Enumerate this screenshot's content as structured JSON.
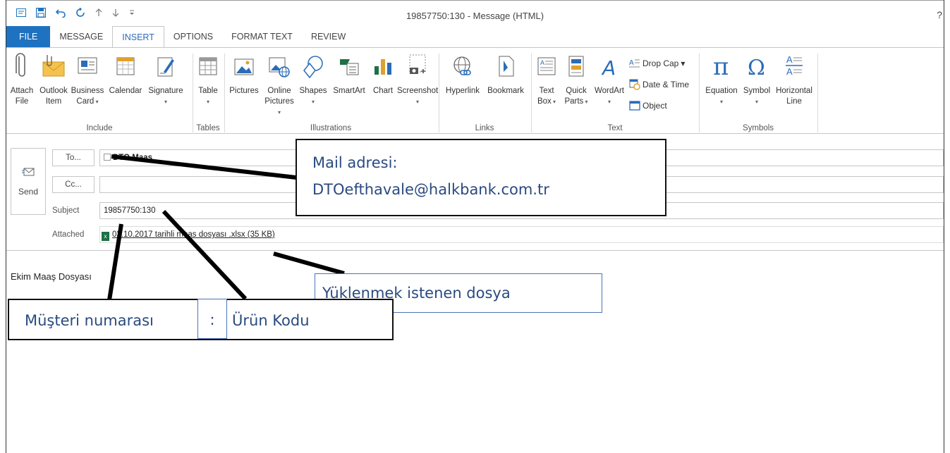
{
  "window": {
    "title": "19857750:130 - Message (HTML)",
    "help": "?"
  },
  "tabs": [
    "FILE",
    "MESSAGE",
    "INSERT",
    "OPTIONS",
    "FORMAT TEXT",
    "REVIEW"
  ],
  "active_tab": "INSERT",
  "ribbon": {
    "include": {
      "label": "Include",
      "buttons": [
        {
          "line1": "Attach",
          "line2": "File"
        },
        {
          "line1": "Outlook",
          "line2": "Item"
        },
        {
          "line1": "Business",
          "line2": "Card"
        },
        {
          "line1": "Calendar",
          "line2": ""
        },
        {
          "line1": "Signature",
          "line2": ""
        }
      ]
    },
    "tables": {
      "label": "Tables",
      "buttons": [
        {
          "line1": "Table",
          "line2": ""
        }
      ]
    },
    "illustrations": {
      "label": "Illustrations",
      "buttons": [
        {
          "line1": "Pictures",
          "line2": ""
        },
        {
          "line1": "Online",
          "line2": "Pictures"
        },
        {
          "line1": "Shapes",
          "line2": ""
        },
        {
          "line1": "SmartArt",
          "line2": ""
        },
        {
          "line1": "Chart",
          "line2": ""
        },
        {
          "line1": "Screenshot",
          "line2": ""
        }
      ]
    },
    "links": {
      "label": "Links",
      "buttons": [
        {
          "line1": "Hyperlink",
          "line2": ""
        },
        {
          "line1": "Bookmark",
          "line2": ""
        }
      ]
    },
    "text": {
      "label": "Text",
      "buttons": [
        {
          "line1": "Text",
          "line2": "Box"
        },
        {
          "line1": "Quick",
          "line2": "Parts"
        },
        {
          "line1": "WordArt",
          "line2": ""
        }
      ],
      "small": [
        "Drop Cap",
        "Date & Time",
        "Object"
      ]
    },
    "symbols": {
      "label": "Symbols",
      "buttons": [
        {
          "line1": "Equation",
          "line2": ""
        },
        {
          "line1": "Symbol",
          "line2": ""
        },
        {
          "line1": "Horizontal",
          "line2": "Line"
        }
      ]
    }
  },
  "compose": {
    "send_label": "Send",
    "to_button": "To...",
    "cc_button": "Cc...",
    "to_value": "DTO Maas",
    "cc_value": "",
    "subject_label": "Subject",
    "subject_value": "19857750:130",
    "attached_label": "Attached",
    "attachment": "03.10.2017 tarihli maas dosyası .xlsx (35 KB)"
  },
  "body_text": "Ekim Maaş Dosyası",
  "annotations": {
    "mail_title": "Mail adresi:",
    "mail_value": "DTOefthavale@halkbank.com.tr",
    "file": "Yüklenmek istenen dosya",
    "customer": "Müşteri numarası",
    "separator": ":",
    "product": "Ürün Kodu"
  },
  "colors": {
    "file_tab": "#1e72c0",
    "accent": "#2b6cb8",
    "annotation_text": "#2a4a80",
    "excel_green": "#1d7145"
  }
}
